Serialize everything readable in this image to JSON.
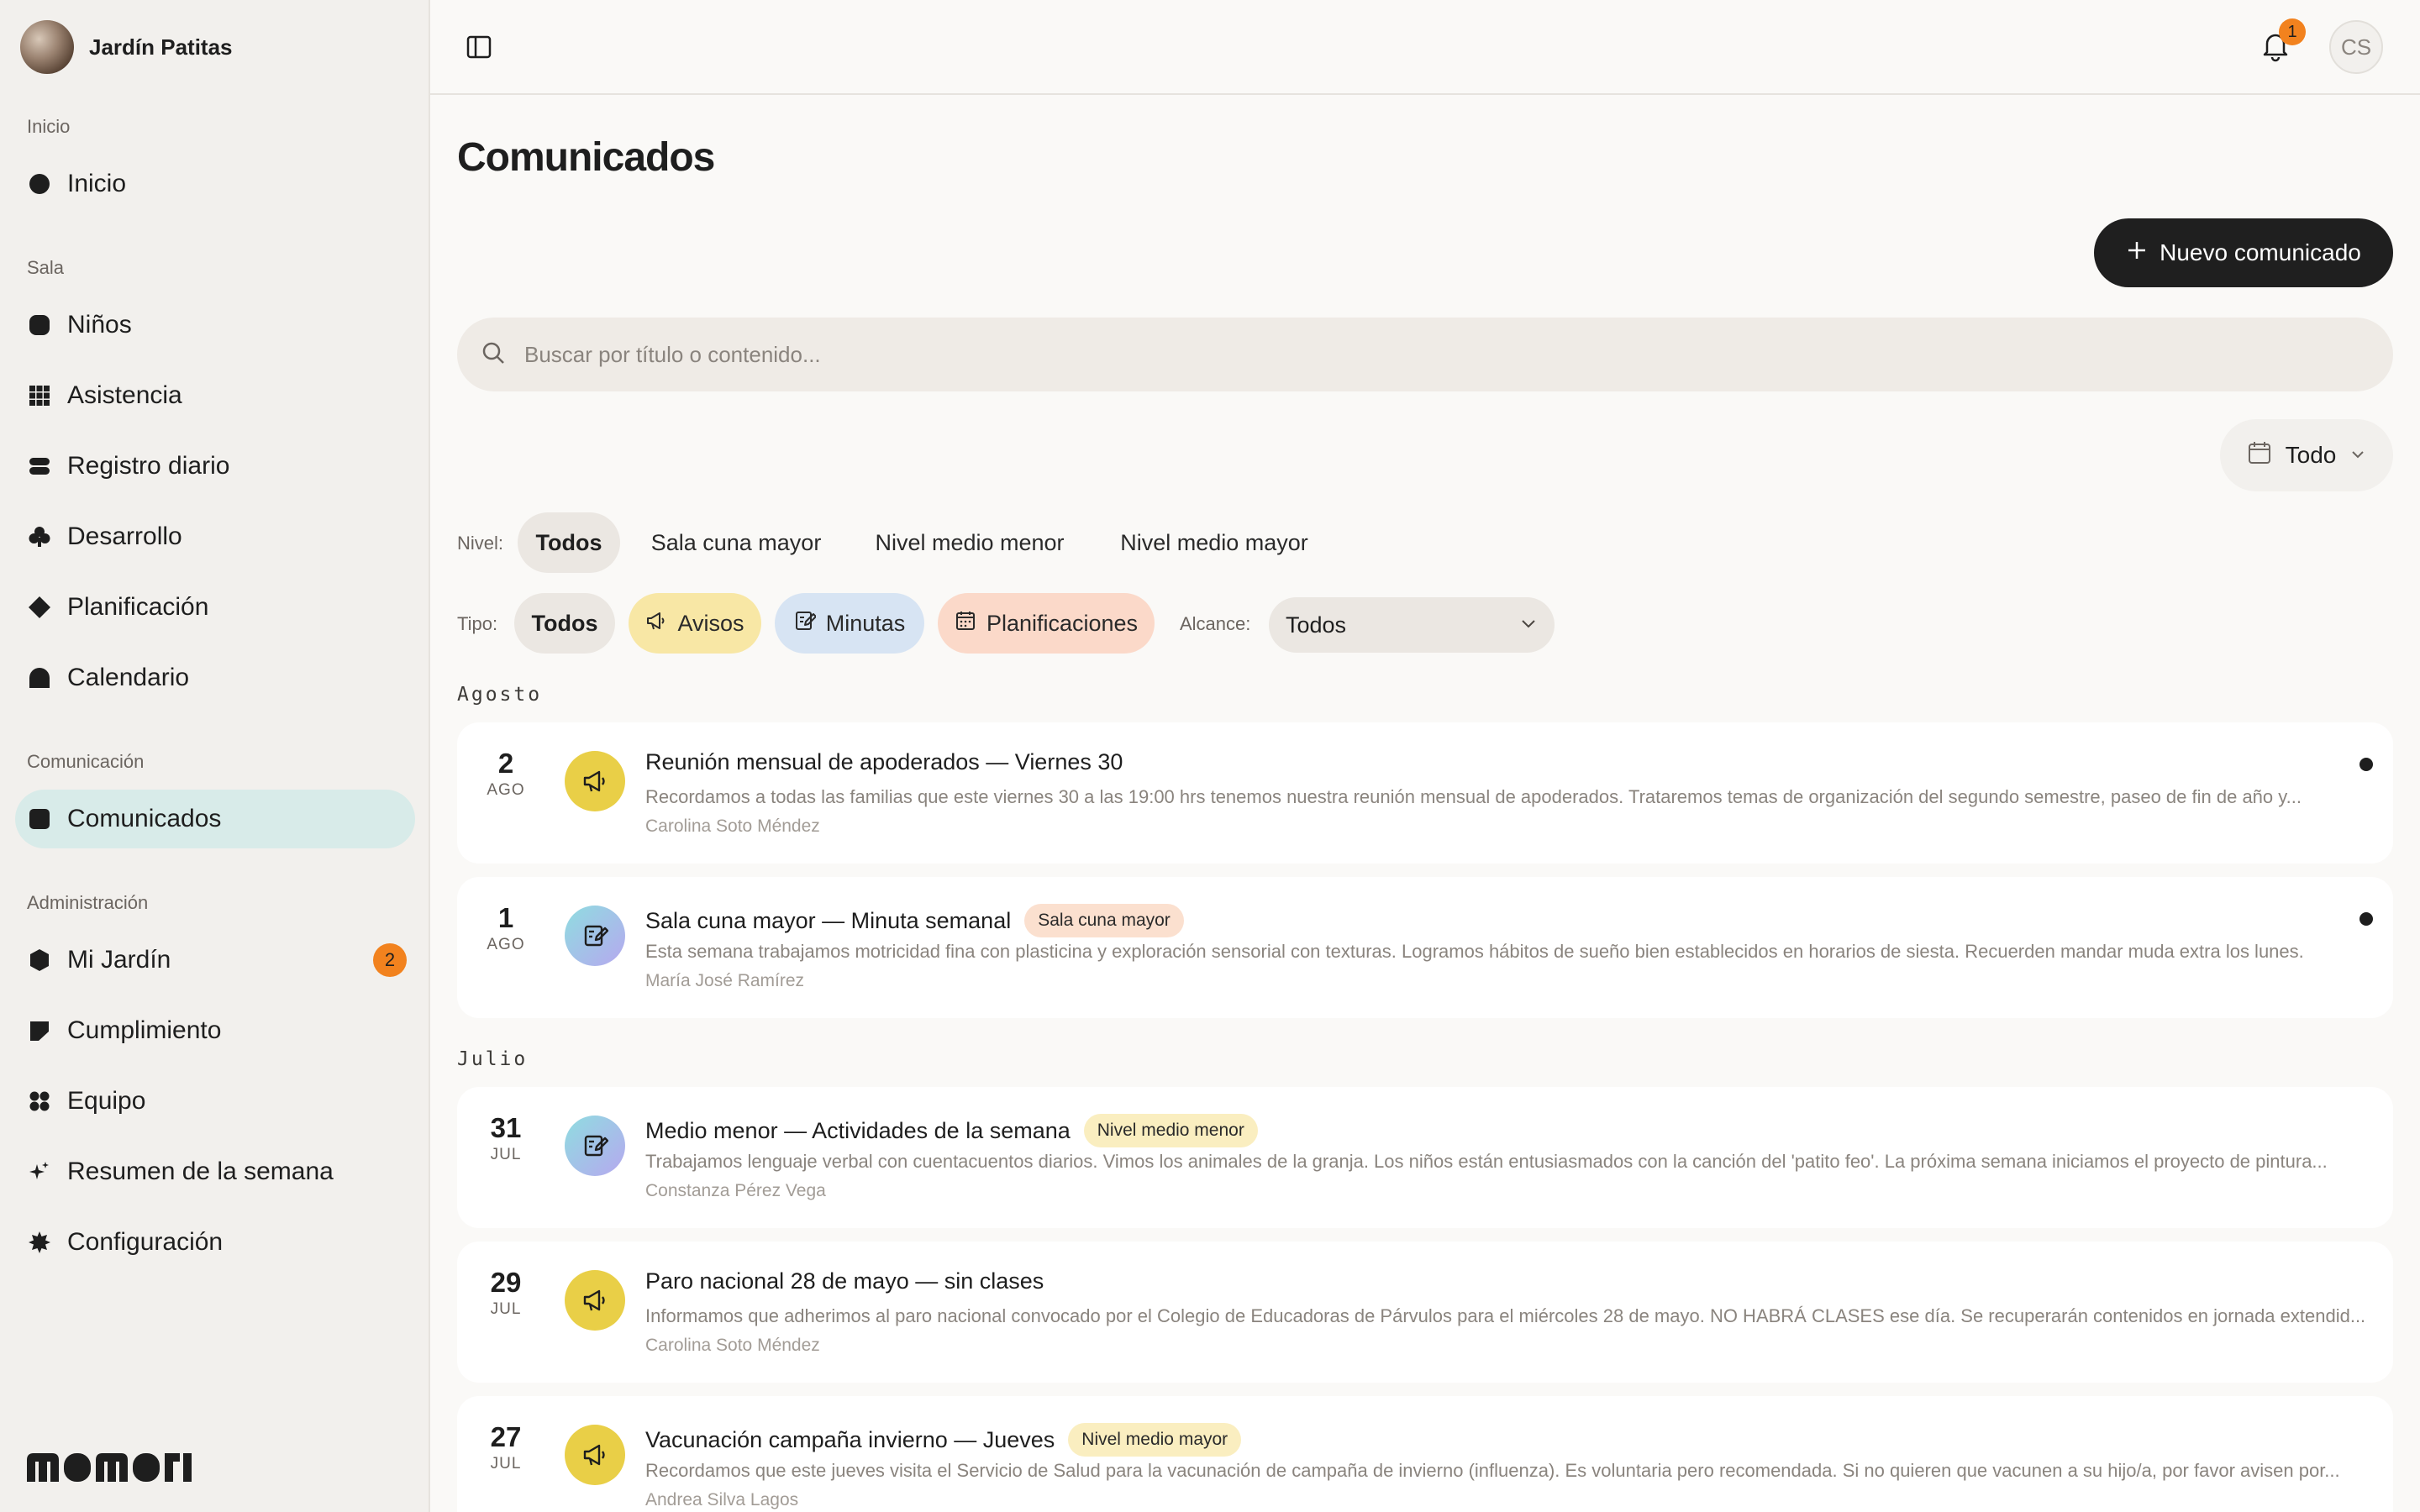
{
  "brand": {
    "name": "Jardín Patitas"
  },
  "sidebar": {
    "sections": [
      {
        "label": "Inicio",
        "items": [
          {
            "label": "Inicio",
            "icon": "circle-icon"
          }
        ]
      },
      {
        "label": "Sala",
        "items": [
          {
            "label": "Niños",
            "icon": "rounded-square-icon"
          },
          {
            "label": "Asistencia",
            "icon": "grid-icon"
          },
          {
            "label": "Registro diario",
            "icon": "stacked-bars-icon"
          },
          {
            "label": "Desarrollo",
            "icon": "club-icon"
          },
          {
            "label": "Planificación",
            "icon": "diamond-icon"
          },
          {
            "label": "Calendario",
            "icon": "arch-icon"
          }
        ]
      },
      {
        "label": "Comunicación",
        "items": [
          {
            "label": "Comunicados",
            "icon": "square-icon",
            "active": true
          }
        ]
      },
      {
        "label": "Administración",
        "items": [
          {
            "label": "Mi Jardín",
            "icon": "badge-icon",
            "badge": "2"
          },
          {
            "label": "Cumplimiento",
            "icon": "folded-flag-icon"
          },
          {
            "label": "Equipo",
            "icon": "dots-grid-icon"
          },
          {
            "label": "Resumen de la semana",
            "icon": "sparkles-icon"
          },
          {
            "label": "Configuración",
            "icon": "gear-icon"
          }
        ]
      }
    ],
    "logo": "momori"
  },
  "topbar": {
    "notifications": "1",
    "user_initials": "CS"
  },
  "page": {
    "title": "Comunicados",
    "new_button": "Nuevo comunicado",
    "search_placeholder": "Buscar por título o contenido...",
    "date_filter": "Todo"
  },
  "filters": {
    "nivel_label": "Nivel:",
    "nivel_options": [
      "Todos",
      "Sala cuna mayor",
      "Nivel medio menor",
      "Nivel medio mayor"
    ],
    "tipo_label": "Tipo:",
    "tipo_options": [
      "Todos",
      "Avisos",
      "Minutas",
      "Planificaciones"
    ],
    "alcance_label": "Alcance:",
    "alcance_value": "Todos"
  },
  "groups": [
    {
      "month": "Agosto",
      "items": [
        {
          "day": "2",
          "mon": "AGO",
          "type": "aviso",
          "title": "Reunión mensual de apoderados — Viernes 30",
          "tag": "",
          "body": "Recordamos a todas las familias que este viernes 30 a las 19:00 hrs tenemos nuestra reunión mensual de apoderados. Trataremos temas de organización del segundo semestre, paseo de fin de año y...",
          "author": "Carolina Soto Méndez",
          "unread": true
        },
        {
          "day": "1",
          "mon": "AGO",
          "type": "minuta",
          "title": "Sala cuna mayor — Minuta semanal",
          "tag": "Sala cuna mayor",
          "body": "Esta semana trabajamos motricidad fina con plasticina y exploración sensorial con texturas. Logramos hábitos de sueño bien establecidos en horarios de siesta. Recuerden mandar muda extra los lunes.",
          "author": "María José Ramírez",
          "unread": true
        }
      ]
    },
    {
      "month": "Julio",
      "items": [
        {
          "day": "31",
          "mon": "JUL",
          "type": "minuta",
          "title": "Medio menor — Actividades de la semana",
          "tag": "Nivel medio menor",
          "body": "Trabajamos lenguaje verbal con cuentacuentos diarios. Vimos los animales de la granja. Los niños están entusiasmados con la canción del 'patito feo'. La próxima semana iniciamos el proyecto de pintura...",
          "author": "Constanza Pérez Vega",
          "unread": false
        },
        {
          "day": "29",
          "mon": "JUL",
          "type": "aviso",
          "title": "Paro nacional 28 de mayo — sin clases",
          "tag": "",
          "body": "Informamos que adherimos al paro nacional convocado por el Colegio de Educadoras de Párvulos para el miércoles 28 de mayo. NO HABRÁ CLASES ese día. Se recuperarán contenidos en jornada extendid...",
          "author": "Carolina Soto Méndez",
          "unread": false
        },
        {
          "day": "27",
          "mon": "JUL",
          "type": "aviso",
          "title": "Vacunación campaña invierno — Jueves",
          "tag": "Nivel medio mayor",
          "body": "Recordamos que este jueves visita el Servicio de Salud para la vacunación de campaña de invierno (influenza). Es voluntaria pero recomendada. Si no quieren que vacunen a su hijo/a, por favor avisen por...",
          "author": "Andrea Silva Lagos",
          "unread": false
        }
      ]
    }
  ]
}
